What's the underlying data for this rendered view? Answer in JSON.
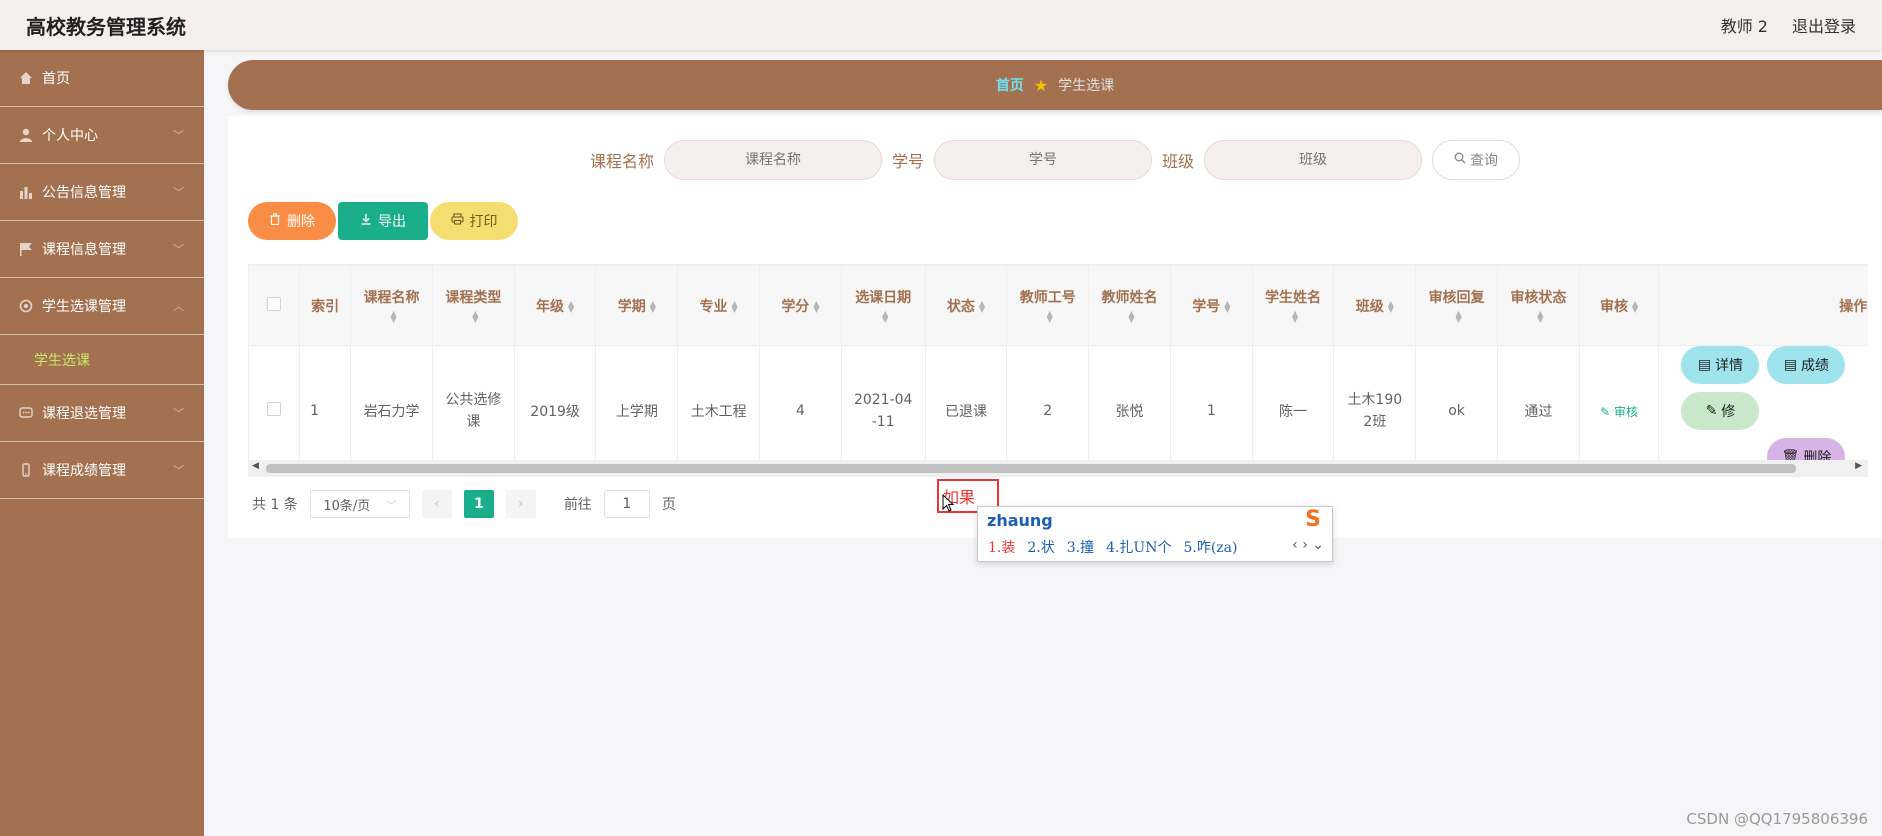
{
  "app": {
    "title": "高校教务管理系统",
    "user": "教师 2",
    "logout": "退出登录"
  },
  "sidebar": {
    "items": [
      {
        "label": "首页",
        "icon": "home-icon"
      },
      {
        "label": "个人中心",
        "icon": "user-icon"
      },
      {
        "label": "公告信息管理",
        "icon": "chart-icon"
      },
      {
        "label": "课程信息管理",
        "icon": "flag-icon"
      },
      {
        "label": "学生选课管理",
        "icon": "gear-icon"
      },
      {
        "label": "课程退选管理",
        "icon": "message-icon"
      },
      {
        "label": "课程成绩管理",
        "icon": "phone-icon"
      }
    ],
    "sub_item": "学生选课"
  },
  "breadcrumb": {
    "home": "首页",
    "current": "学生选课"
  },
  "search": {
    "course_label": "课程名称",
    "course_placeholder": "课程名称",
    "sid_label": "学号",
    "sid_placeholder": "学号",
    "class_label": "班级",
    "class_placeholder": "班级",
    "button": "查询"
  },
  "actions": {
    "delete": "删除",
    "export": "导出",
    "print": "打印"
  },
  "table": {
    "headers": [
      "索引",
      "课程名称",
      "课程类型",
      "年级",
      "学期",
      "专业",
      "学分",
      "选课日期",
      "状态",
      "教师工号",
      "教师姓名",
      "学号",
      "学生姓名",
      "班级",
      "审核回复",
      "审核状态",
      "审核",
      "操作"
    ],
    "rows": [
      {
        "index": "1",
        "course": "岩石力学",
        "type": "公共选修课",
        "grade": "2019级",
        "term": "上学期",
        "major": "土木工程",
        "credit": "4",
        "date": "2021-04-11",
        "status": "已退课",
        "tid": "2",
        "tname": "张悦",
        "sid": "1",
        "sname": "陈一",
        "class": "土木1902班",
        "reply": "ok",
        "audit_status": "通过",
        "audit": "审核"
      }
    ],
    "ops": {
      "detail": "详情",
      "score": "成绩",
      "edit": "修",
      "delete": "删除"
    }
  },
  "pager": {
    "total": "共 1 条",
    "page_size": "10条/页",
    "current": "1",
    "goto": "前往",
    "goto_value": "1",
    "page_unit": "页"
  },
  "ime": {
    "composed": "如果",
    "input": "zhaung",
    "candidates": [
      "1.装",
      "2.状",
      "3.撞",
      "4.扎UN个",
      "5.咋(za)"
    ]
  },
  "watermark": "CSDN @QQ1795806396",
  "colors": {
    "brand": "#a47150",
    "accent": "#1aaf8a",
    "sub_active": "#c8e86a"
  }
}
